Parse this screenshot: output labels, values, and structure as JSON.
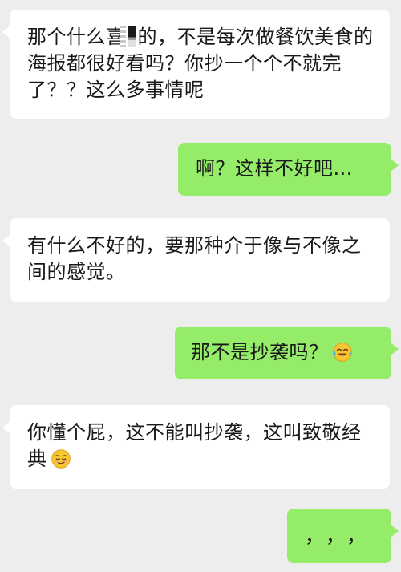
{
  "conversation": {
    "messages": [
      {
        "from": "other",
        "text_before_redaction": "那个什么喜",
        "text_after_redaction": "的，不是每次做餐饮美食的海报都很好看吗？你抄一个个不就完了？？这么多事情呢"
      },
      {
        "from": "me",
        "text": "啊？这样不好吧..."
      },
      {
        "from": "other",
        "text": "有什么不好的，要那种介于像与不像之间的感觉。"
      },
      {
        "from": "me",
        "text": "那不是抄袭吗？",
        "emoji": "crying-laughing-emoji"
      },
      {
        "from": "other",
        "text": "你懂个屁，这不能叫抄袭，这叫致敬经典",
        "emoji": "smirking-emoji"
      },
      {
        "from": "me",
        "text": "，，，"
      }
    ]
  },
  "colors": {
    "background": "#ededed",
    "incoming_bubble": "#ffffff",
    "outgoing_bubble": "#95ec69",
    "text": "#191919"
  }
}
